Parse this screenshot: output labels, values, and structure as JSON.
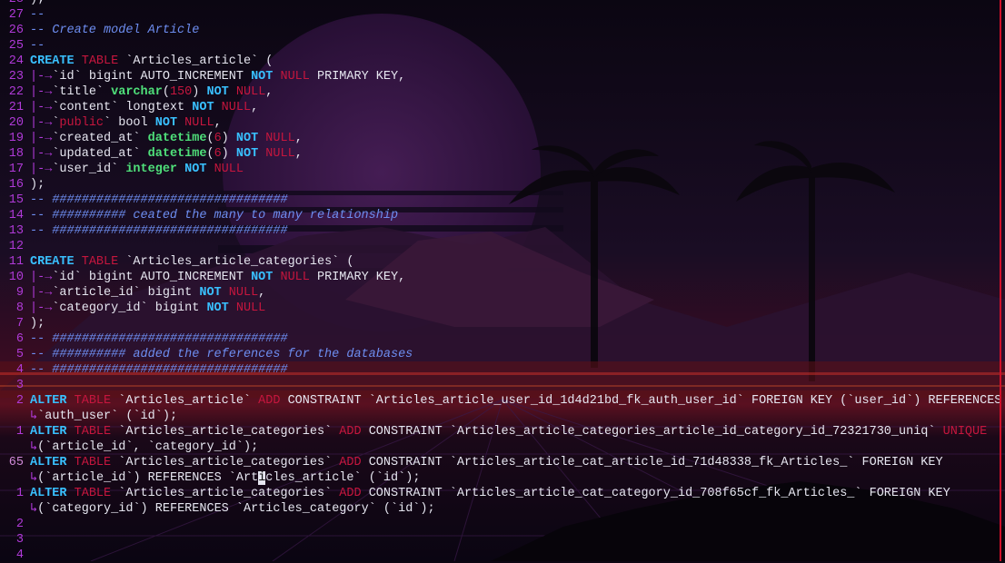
{
  "editor": {
    "lines": [
      {
        "ln": "28",
        "code": ");"
      },
      {
        "ln": "27",
        "code": "--",
        "cls": "cm"
      },
      {
        "ln": "26",
        "code": "-- Create model Article",
        "cls": "cm"
      },
      {
        "ln": "25",
        "code": "--",
        "cls": "cm"
      },
      {
        "ln": "24",
        "segments": [
          {
            "t": "CREATE",
            "c": "kw"
          },
          {
            "t": " "
          },
          {
            "t": "TABLE",
            "c": "kw2"
          },
          {
            "t": " `Articles_article` ("
          }
        ]
      },
      {
        "ln": "23",
        "segments": [
          {
            "t": "|-→",
            "c": "ind"
          },
          {
            "t": "`id` bigint AUTO_INCREMENT "
          },
          {
            "t": "NOT",
            "c": "kw"
          },
          {
            "t": " "
          },
          {
            "t": "NULL",
            "c": "kw2"
          },
          {
            "t": " PRIMARY KEY,"
          }
        ]
      },
      {
        "ln": "22",
        "segments": [
          {
            "t": "|-→",
            "c": "ind"
          },
          {
            "t": "`title` "
          },
          {
            "t": "varchar",
            "c": "ty"
          },
          {
            "t": "("
          },
          {
            "t": "150",
            "c": "num"
          },
          {
            "t": ") "
          },
          {
            "t": "NOT",
            "c": "kw"
          },
          {
            "t": " "
          },
          {
            "t": "NULL",
            "c": "kw2"
          },
          {
            "t": ","
          }
        ]
      },
      {
        "ln": "21",
        "segments": [
          {
            "t": "|-→",
            "c": "ind"
          },
          {
            "t": "`content` longtext "
          },
          {
            "t": "NOT",
            "c": "kw"
          },
          {
            "t": " "
          },
          {
            "t": "NULL",
            "c": "kw2"
          },
          {
            "t": ","
          }
        ]
      },
      {
        "ln": "20",
        "segments": [
          {
            "t": "|-→",
            "c": "ind"
          },
          {
            "t": "`"
          },
          {
            "t": "public",
            "c": "kw2"
          },
          {
            "t": "` bool "
          },
          {
            "t": "NOT",
            "c": "kw"
          },
          {
            "t": " "
          },
          {
            "t": "NULL",
            "c": "kw2"
          },
          {
            "t": ","
          }
        ]
      },
      {
        "ln": "19",
        "segments": [
          {
            "t": "|-→",
            "c": "ind"
          },
          {
            "t": "`created_at` "
          },
          {
            "t": "datetime",
            "c": "ty"
          },
          {
            "t": "("
          },
          {
            "t": "6",
            "c": "num"
          },
          {
            "t": ") "
          },
          {
            "t": "NOT",
            "c": "kw"
          },
          {
            "t": " "
          },
          {
            "t": "NULL",
            "c": "kw2"
          },
          {
            "t": ","
          }
        ]
      },
      {
        "ln": "18",
        "segments": [
          {
            "t": "|-→",
            "c": "ind"
          },
          {
            "t": "`updated_at` "
          },
          {
            "t": "datetime",
            "c": "ty"
          },
          {
            "t": "("
          },
          {
            "t": "6",
            "c": "num"
          },
          {
            "t": ") "
          },
          {
            "t": "NOT",
            "c": "kw"
          },
          {
            "t": " "
          },
          {
            "t": "NULL",
            "c": "kw2"
          },
          {
            "t": ","
          }
        ]
      },
      {
        "ln": "17",
        "segments": [
          {
            "t": "|-→",
            "c": "ind"
          },
          {
            "t": "`user_id` "
          },
          {
            "t": "integer",
            "c": "ty"
          },
          {
            "t": " "
          },
          {
            "t": "NOT",
            "c": "kw"
          },
          {
            "t": " "
          },
          {
            "t": "NULL",
            "c": "kw2"
          }
        ]
      },
      {
        "ln": "16",
        "code": ");"
      },
      {
        "ln": "15",
        "code": "-- ################################",
        "cls": "cm"
      },
      {
        "ln": "14",
        "code": "-- ########## ceated the many to many relationship",
        "cls": "cm"
      },
      {
        "ln": "13",
        "code": "-- ################################",
        "cls": "cm"
      },
      {
        "ln": "12",
        "code": ""
      },
      {
        "ln": "11",
        "segments": [
          {
            "t": "CREATE",
            "c": "kw"
          },
          {
            "t": " "
          },
          {
            "t": "TABLE",
            "c": "kw2"
          },
          {
            "t": " `Articles_article_categories` ("
          }
        ]
      },
      {
        "ln": "10",
        "segments": [
          {
            "t": "|-→",
            "c": "ind"
          },
          {
            "t": "`id` bigint AUTO_INCREMENT "
          },
          {
            "t": "NOT",
            "c": "kw"
          },
          {
            "t": " "
          },
          {
            "t": "NULL",
            "c": "kw2"
          },
          {
            "t": " PRIMARY KEY,"
          }
        ]
      },
      {
        "ln": "9",
        "segments": [
          {
            "t": "|-→",
            "c": "ind"
          },
          {
            "t": "`article_id` bigint "
          },
          {
            "t": "NOT",
            "c": "kw"
          },
          {
            "t": " "
          },
          {
            "t": "NULL",
            "c": "kw2"
          },
          {
            "t": ","
          }
        ]
      },
      {
        "ln": "8",
        "segments": [
          {
            "t": "|-→",
            "c": "ind"
          },
          {
            "t": "`category_id` bigint "
          },
          {
            "t": "NOT",
            "c": "kw"
          },
          {
            "t": " "
          },
          {
            "t": "NULL",
            "c": "kw2"
          }
        ]
      },
      {
        "ln": "7",
        "code": ");"
      },
      {
        "ln": "6",
        "code": "-- ################################",
        "cls": "cm"
      },
      {
        "ln": "5",
        "code": "-- ########## added the references for the databases",
        "cls": "cm"
      },
      {
        "ln": "4",
        "code": "-- ################################",
        "cls": "cm"
      },
      {
        "ln": "3",
        "code": ""
      },
      {
        "ln": "2",
        "segments": [
          {
            "t": "ALTER",
            "c": "kw"
          },
          {
            "t": " "
          },
          {
            "t": "TABLE",
            "c": "kw2"
          },
          {
            "t": " `Articles_article` "
          },
          {
            "t": "ADD",
            "c": "kw2"
          },
          {
            "t": " CONSTRAINT `Articles_article_user_id_1d4d21bd_fk_auth_user_id` FOREIGN KEY (`user_id`) REFERENCES"
          }
        ]
      },
      {
        "ln": "",
        "segments": [
          {
            "t": "↳",
            "c": "wrap"
          },
          {
            "t": "`auth_user` (`id`);"
          }
        ]
      },
      {
        "ln": "1",
        "segments": [
          {
            "t": "ALTER",
            "c": "kw"
          },
          {
            "t": " "
          },
          {
            "t": "TABLE",
            "c": "kw2"
          },
          {
            "t": " `Articles_article_categories` "
          },
          {
            "t": "ADD",
            "c": "kw2"
          },
          {
            "t": " CONSTRAINT `Articles_article_categories_article_id_category_id_72321730_uniq` "
          },
          {
            "t": "UNIQUE",
            "c": "kw2"
          }
        ]
      },
      {
        "ln": "",
        "segments": [
          {
            "t": "↳",
            "c": "wrap"
          },
          {
            "t": "(`article_id`, `category_id`);"
          }
        ]
      },
      {
        "ln": "65",
        "cur": true,
        "segments": [
          {
            "t": "ALTER",
            "c": "kw"
          },
          {
            "t": " "
          },
          {
            "t": "TABLE",
            "c": "kw2"
          },
          {
            "t": " `Articles_article_categories` "
          },
          {
            "t": "ADD",
            "c": "kw2"
          },
          {
            "t": " CONSTRAINT `Articles_article_cat_article_id_71d48338_fk_Articles_` FOREIGN KEY"
          }
        ]
      },
      {
        "ln": "",
        "segments": [
          {
            "t": "↳",
            "c": "wrap"
          },
          {
            "t": "(`article_id`) REFERENCES `Art"
          },
          {
            "t": "i",
            "c": "cursor"
          },
          {
            "t": "cles_article` (`id`);"
          }
        ]
      },
      {
        "ln": "1",
        "segments": [
          {
            "t": "ALTER",
            "c": "kw"
          },
          {
            "t": " "
          },
          {
            "t": "TABLE",
            "c": "kw2"
          },
          {
            "t": " `Articles_article_categories` "
          },
          {
            "t": "ADD",
            "c": "kw2"
          },
          {
            "t": " CONSTRAINT `Articles_article_cat_category_id_708f65cf_fk_Articles_` FOREIGN KEY"
          }
        ]
      },
      {
        "ln": "",
        "segments": [
          {
            "t": "↳",
            "c": "wrap"
          },
          {
            "t": "(`category_id`) REFERENCES `Articles_category` (`id`);"
          }
        ]
      },
      {
        "ln": "2",
        "code": ""
      },
      {
        "ln": "3",
        "code": ""
      },
      {
        "ln": "4",
        "code": ""
      }
    ]
  },
  "colors": {
    "keyword": "#39c0ff",
    "keyword_alt": "#c6163e",
    "type": "#4fe07a",
    "comment": "#6d8df0",
    "line_number": "#b03ad8"
  }
}
